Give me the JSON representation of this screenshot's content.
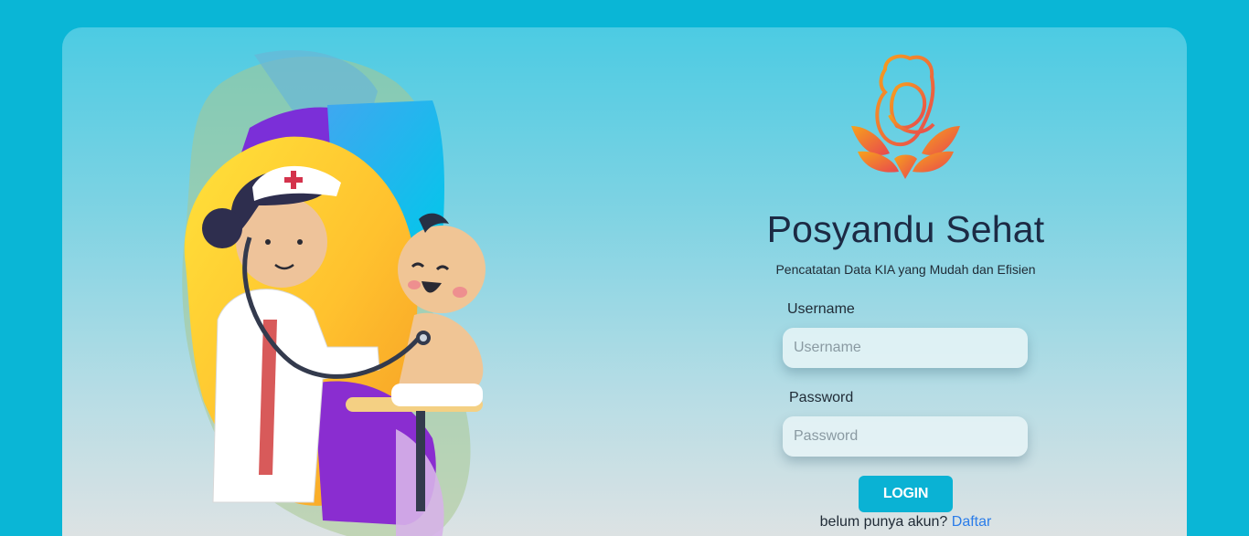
{
  "app": {
    "title": "Posyandu Sehat",
    "subtitle": "Pencatatan Data KIA yang Mudah dan Efisien"
  },
  "form": {
    "username_label": "Username",
    "username_placeholder": "Username",
    "password_label": "Password",
    "password_placeholder": "Password",
    "login_label": "LOGIN",
    "register_prompt": "belum punya akun?",
    "register_link": "Daftar"
  },
  "colors": {
    "page_background": "#0ab6d6",
    "button": "#0ab2d4",
    "title": "#1c2a44",
    "link": "#2b7de9",
    "logo_gradient_start": "#f7a21b",
    "logo_gradient_end": "#e8474f"
  },
  "icons": {
    "logo": "mother-child-lotus-logo",
    "illustration": "doctor-examining-baby-illustration"
  }
}
